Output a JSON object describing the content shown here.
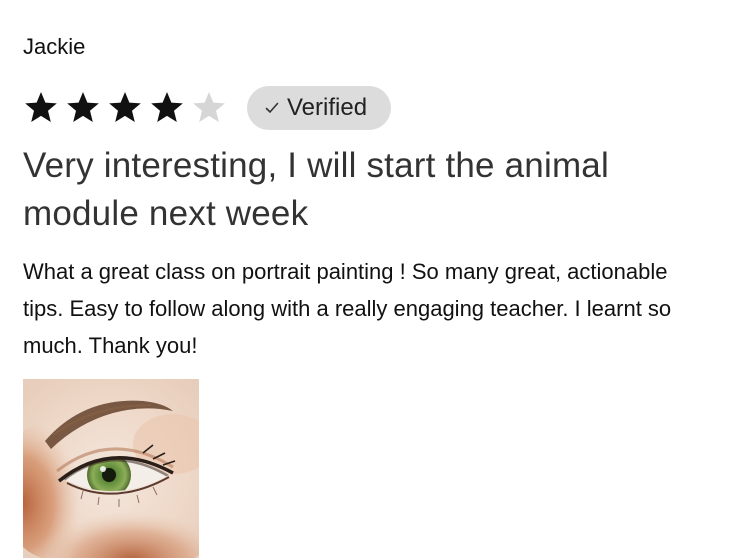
{
  "review": {
    "author": "Jackie",
    "rating": {
      "value": 4,
      "max": 5,
      "filled_color": "#111111",
      "empty_color": "#d6d6d6"
    },
    "badge": {
      "icon": "check-icon",
      "label": "Verified"
    },
    "title": "Very interesting, I will start the animal module next week",
    "body": "What a great class on portrait painting ! So many great, actionable tips. Easy to follow along with a really engaging teacher. I learnt so much. Thank you!",
    "photo": {
      "subject": "watercolor-eye-painting"
    }
  }
}
